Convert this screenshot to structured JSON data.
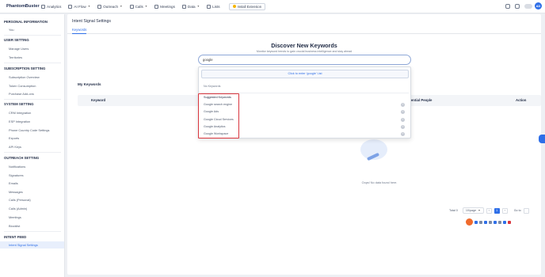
{
  "brand": {
    "name": "PhantomBuster",
    "accent": "#2f6fe8"
  },
  "topnav": [
    {
      "label": "Analytics",
      "has_caret": false
    },
    {
      "label": "AI Flow",
      "has_caret": true
    },
    {
      "label": "Outreach",
      "has_caret": true
    },
    {
      "label": "Calls",
      "has_caret": true
    },
    {
      "label": "Meetings",
      "has_caret": false
    },
    {
      "label": "Data",
      "has_caret": true
    },
    {
      "label": "Lists",
      "has_caret": false
    }
  ],
  "install_extension": "Install Extension",
  "user_initials": "AD",
  "sidebar": {
    "personal_title": "PERSONAL INFORMATION",
    "personal_items": [
      "You"
    ],
    "user_title": "USER SETTING",
    "user_items": [
      "Manage Users",
      "Territories"
    ],
    "subscription_title": "SUBSCRIPTION SETTING",
    "subscription_items": [
      "Subscription Overview",
      "Token Consumption",
      "Purchase Add-ons"
    ],
    "system_title": "SYSTEM SETTING",
    "system_items": [
      "CRM Integration",
      "ESP Integration",
      "Phone Country Code Settings",
      "Exports",
      "API Keys"
    ],
    "outreach_title": "OUTREACH SETTING",
    "outreach_items": [
      "Notifications",
      "Signatures",
      "Emails",
      "Messages",
      "Calls (Personal)",
      "Calls (Admin)",
      "Meetings",
      "Blocklist"
    ],
    "intent_title": "INTENT FEED",
    "intent_items": [
      "Intent Signal Settings"
    ]
  },
  "main": {
    "title": "Intent Signal Settings",
    "tab": "Keywords",
    "discover_title": "Discover New Keywords",
    "discover_subtitle": "Monitor keyword trends to gain crucial business intelligence and stay ahead",
    "search_value": "google",
    "my_keywords": "My Keywords",
    "table_headers": {
      "keyword": "Keyword",
      "potential": "Potential People",
      "action": "Action"
    },
    "empty_text": "Oops! No data found here.",
    "pagination": {
      "total": "Total 0",
      "per_page": "10/page",
      "page": "1",
      "goto": "Go to"
    }
  },
  "dropdown": {
    "click_to_enter": "Click to enter 'google' List",
    "no_keywords": "No Keywords",
    "suggested_title": "Suggested Keywords",
    "suggestions": [
      "Google search engine",
      "Google Ads",
      "Google Cloud Services",
      "Google Analytics",
      "Google Workspace"
    ]
  }
}
